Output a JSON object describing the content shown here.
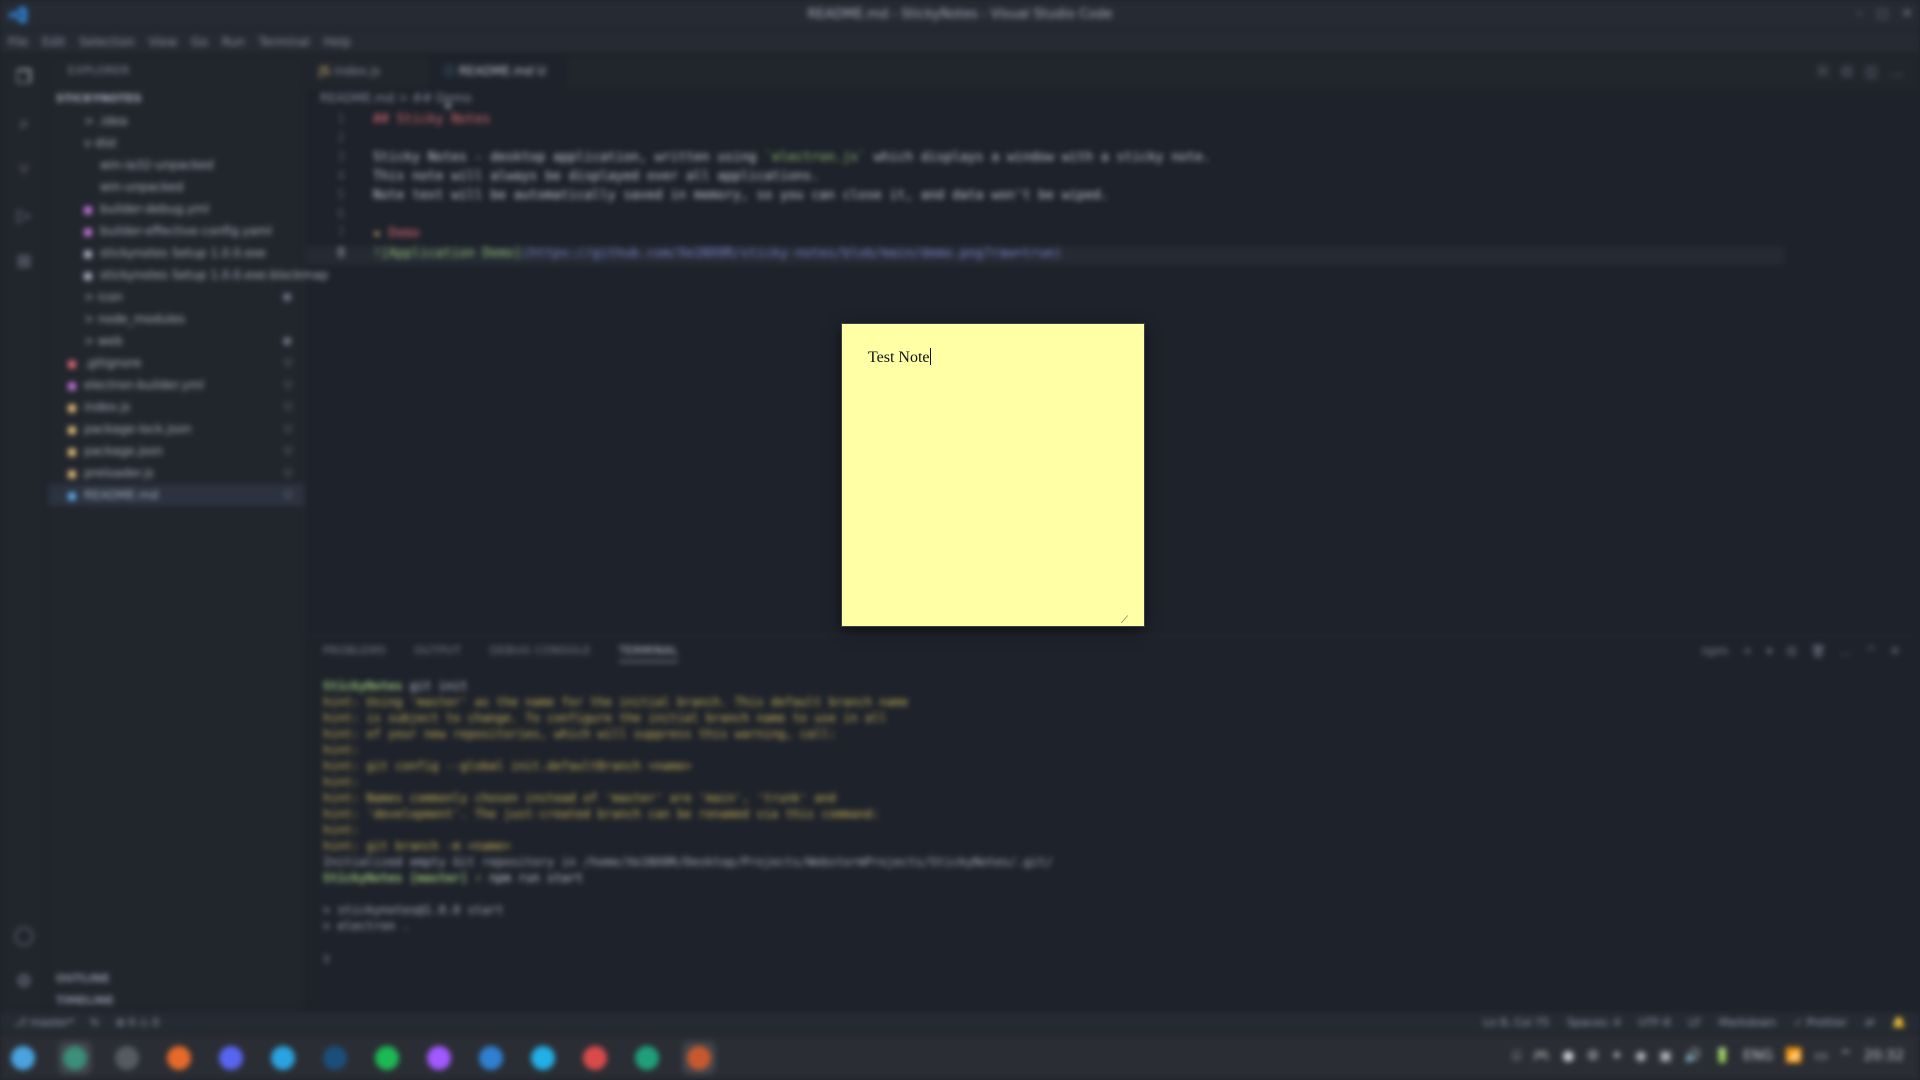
{
  "window": {
    "title": "README.md - StickyNotes - Visual Studio Code",
    "controls": [
      "–",
      "□",
      "✕"
    ]
  },
  "menu": [
    "File",
    "Edit",
    "Selection",
    "View",
    "Go",
    "Run",
    "Terminal",
    "Help"
  ],
  "sidebar": {
    "header": "EXPLORER",
    "project": "STICKYNOTES",
    "items": [
      {
        "label": "> .idea",
        "icon": "folder-icon",
        "badge": ""
      },
      {
        "label": "v dist",
        "icon": "folder-open-icon",
        "badge": ""
      },
      {
        "label": "win-ia32-unpacked",
        "icon": "folder-icon",
        "badge": ""
      },
      {
        "label": "win-unpacked",
        "icon": "folder-icon",
        "badge": ""
      },
      {
        "label": "builder-debug.yml",
        "icon": "yml-icon",
        "badge": ""
      },
      {
        "label": "builder-effective-config.yaml",
        "icon": "yml-icon",
        "badge": ""
      },
      {
        "label": "stickynotes Setup 1.0.0.exe",
        "icon": "exe-icon",
        "badge": ""
      },
      {
        "label": "stickynotes Setup 1.0.0.exe.blockmap",
        "icon": "file-icon",
        "badge": ""
      },
      {
        "label": "> icon",
        "icon": "folder-icon",
        "badge": "●"
      },
      {
        "label": "> node_modules",
        "icon": "folder-icon",
        "badge": ""
      },
      {
        "label": "> web",
        "icon": "folder-icon",
        "badge": "●"
      },
      {
        "label": ".gitignore",
        "icon": "git-icon",
        "badge": "U"
      },
      {
        "label": "electron-builder.yml",
        "icon": "yml-icon",
        "badge": "U"
      },
      {
        "label": "index.js",
        "icon": "js-icon",
        "badge": "U"
      },
      {
        "label": "package-lock.json",
        "icon": "json-icon",
        "badge": "U"
      },
      {
        "label": "package.json",
        "icon": "json-icon",
        "badge": "U"
      },
      {
        "label": "preloader.js",
        "icon": "js-icon",
        "badge": "U"
      },
      {
        "label": "README.md",
        "icon": "md-icon",
        "badge": "U"
      }
    ],
    "bottom": [
      "OUTLINE",
      "TIMELINE"
    ]
  },
  "tabs": [
    {
      "label": "index.js",
      "close": "U"
    },
    {
      "label": "README.md U",
      "close": "✕"
    }
  ],
  "breadcrumb": "README.md > ## Demo",
  "code": {
    "line_numbers": [
      "1",
      "2",
      "3",
      "4",
      "5",
      "6",
      "7",
      "8"
    ],
    "heading": "## Sticky Notes",
    "desc_prefix": "Sticky Notes - desktop application, written using ",
    "desc_code": "`electron.js`",
    "desc_suffix": " which displays a window with a sticky note.",
    "line4": "This note will always be displayed over all applications.",
    "line5": "Note text will be automatically saved in memory, so you can close it, and data won't be wiped.",
    "demo_heading": "Demo",
    "demo_emoji": "★",
    "link_alt": "![Application Demo]",
    "link_url": "(https://github.com/Xe1NX0R/sticky-notes/blob/main/demo.png?raw=true)"
  },
  "sticky_note": {
    "text": "Test Note",
    "resize_glyph": "⟋"
  },
  "panel": {
    "tabs": [
      "PROBLEMS",
      "OUTPUT",
      "DEBUG CONSOLE",
      "TERMINAL"
    ],
    "actions": [
      "npm",
      "+",
      "▾",
      "⊟",
      "🗑",
      "…",
      "^",
      "✕"
    ],
    "terminal_lines": [
      {
        "type": "prompt",
        "dir": "StickyNotes",
        "cmd": "git init"
      },
      {
        "type": "hint",
        "text": "hint: Using 'master' as the name for the initial branch. This default branch name"
      },
      {
        "type": "hint",
        "text": "hint: is subject to change. To configure the initial branch name to use in all"
      },
      {
        "type": "hint",
        "text": "hint: of your new repositories, which will suppress this warning, call:"
      },
      {
        "type": "hint",
        "text": "hint:"
      },
      {
        "type": "hint",
        "text": "hint:   git config --global init.defaultBranch <name>"
      },
      {
        "type": "hint",
        "text": "hint:"
      },
      {
        "type": "hint",
        "text": "hint: Names commonly chosen instead of 'master' are 'main', 'trunk' and"
      },
      {
        "type": "hint",
        "text": "hint: 'development'. The just-created branch can be renamed via this command:"
      },
      {
        "type": "hint",
        "text": "hint:"
      },
      {
        "type": "hint",
        "text": "hint:   git branch -m <name>"
      },
      {
        "type": "plain",
        "text": "Initialized empty Git repository in /home/Xe1NX0R/Desktop/Projects/WebstormProjects/StickyNotes/.git/"
      },
      {
        "type": "prompt",
        "dir": "StickyNotes [master] ⚡",
        "cmd": "npm run start"
      },
      {
        "type": "plain",
        "text": ""
      },
      {
        "type": "plain",
        "text": "> stickynotes@1.0.0 start"
      },
      {
        "type": "plain",
        "text": "> electron ."
      },
      {
        "type": "plain",
        "text": ""
      },
      {
        "type": "plain",
        "text": "▯"
      }
    ]
  },
  "statusbar": {
    "left": [
      "⎇ master*",
      "↻",
      "⊗ 0 ⚠ 0"
    ],
    "right": [
      "Ln 8, Col 75",
      "Spaces: 4",
      "UTF-8",
      "LF",
      "Markdown",
      "✓ Prettier",
      "⇄",
      "🔔"
    ]
  },
  "taskbar": {
    "icons": [
      {
        "name": "start-menu-icon",
        "color": "#4aa3df"
      },
      {
        "name": "files-icon",
        "color": "#3c8f78"
      },
      {
        "name": "workspace-icon",
        "color": "#555a63"
      },
      {
        "name": "firefox-icon",
        "color": "#e66a2c"
      },
      {
        "name": "discord-icon",
        "color": "#5865f2"
      },
      {
        "name": "telegram-icon",
        "color": "#2aa3e0"
      },
      {
        "name": "steam-icon",
        "color": "#1b4f7a"
      },
      {
        "name": "spotify-icon",
        "color": "#1db954"
      },
      {
        "name": "figma-icon",
        "color": "#a259ff"
      },
      {
        "name": "vscode-icon",
        "color": "#2f80d1"
      },
      {
        "name": "webstorm-icon",
        "color": "#22b0e6"
      },
      {
        "name": "calendar-icon",
        "color": "#d94b4b"
      },
      {
        "name": "libreoffice-icon",
        "color": "#1fa07a"
      },
      {
        "name": "stickynotes-app-icon",
        "color": "#c8592e"
      }
    ],
    "tray": [
      "⌸",
      "🎮",
      "●",
      "⚙",
      "✦",
      "◉",
      "▣",
      "🔊",
      "🔋",
      "ENG",
      "📶",
      "▭",
      "^"
    ],
    "clock": "20:32"
  },
  "colors": {
    "editor_bg": "#1e222a",
    "sticky_bg": "#ffffa5",
    "accent": "#2f80d1"
  }
}
